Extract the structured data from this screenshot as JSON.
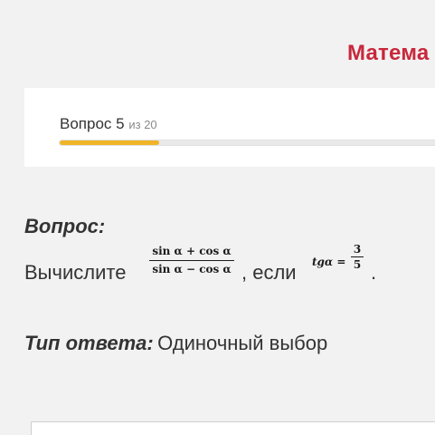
{
  "header": {
    "brand": "Матема"
  },
  "progress": {
    "label_prefix": "Вопрос",
    "current": "5",
    "of_text": "из 20",
    "fraction": 0.25,
    "fill_color": "#f0b428"
  },
  "question": {
    "heading": "Вопрос:",
    "text_before": "Вычислите",
    "formula_numerator": "sin α + cos α",
    "formula_denominator": "sin α − cos α",
    "text_middle": ", если",
    "condition_lhs": "tgα =",
    "condition_numerator": "3",
    "condition_denominator": "5",
    "text_after": "."
  },
  "answer_type": {
    "label": "Тип ответа:",
    "value": "Одиночный выбор"
  },
  "colors": {
    "brand": "#c8283c",
    "background": "#f2f2f2",
    "card": "#ffffff"
  }
}
